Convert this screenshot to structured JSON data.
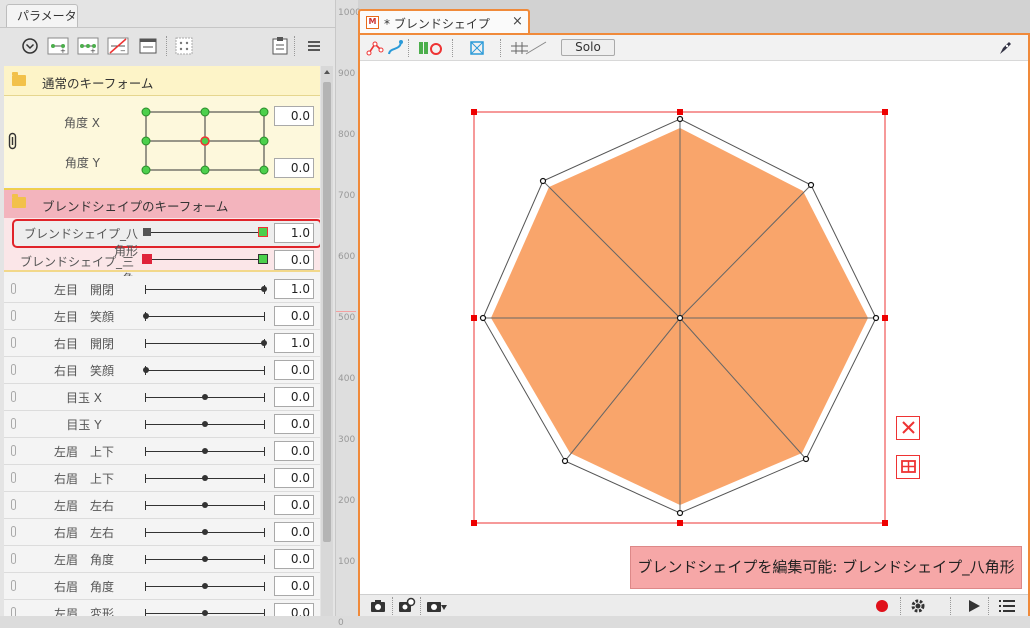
{
  "panel": {
    "tab": "パラメータ"
  },
  "group1": {
    "title": "通常のキーフォーム",
    "params": [
      {
        "label": "角度 X",
        "value": "0.0"
      },
      {
        "label": "角度 Y",
        "value": "0.0"
      }
    ]
  },
  "group2": {
    "title": "ブレンドシェイプのキーフォーム",
    "params": [
      {
        "label": "ブレンドシェイプ_八角形",
        "value": "1.0"
      },
      {
        "label": "ブレンドシェイプ_三角",
        "value": "0.0"
      }
    ]
  },
  "params": [
    {
      "label": "左目　開閉",
      "value": "1.0",
      "pos": 1.0
    },
    {
      "label": "左目　笑顔",
      "value": "0.0",
      "pos": 0.0
    },
    {
      "label": "右目　開閉",
      "value": "1.0",
      "pos": 1.0
    },
    {
      "label": "右目　笑顔",
      "value": "0.0",
      "pos": 0.0
    },
    {
      "label": "目玉 X",
      "value": "0.0",
      "pos": 0.5
    },
    {
      "label": "目玉 Y",
      "value": "0.0",
      "pos": 0.5
    },
    {
      "label": "左眉　上下",
      "value": "0.0",
      "pos": 0.5
    },
    {
      "label": "右眉　上下",
      "value": "0.0",
      "pos": 0.5
    },
    {
      "label": "左眉　左右",
      "value": "0.0",
      "pos": 0.5
    },
    {
      "label": "右眉　左右",
      "value": "0.0",
      "pos": 0.5
    },
    {
      "label": "左眉　角度",
      "value": "0.0",
      "pos": 0.5
    },
    {
      "label": "右眉　角度",
      "value": "0.0",
      "pos": 0.5
    },
    {
      "label": "左眉　変形",
      "value": "0.0",
      "pos": 0.5
    }
  ],
  "ruler": {
    "labels": [
      "1000",
      "900",
      "800",
      "700",
      "600",
      "500",
      "400",
      "300",
      "200",
      "100",
      "0"
    ]
  },
  "viewer": {
    "tab_title": "* ブレンドシェイプ",
    "tab_icon": "M",
    "close": "×",
    "solo_label": "Solo",
    "status": "ブレンドシェイプを編集可能: ブレンドシェイプ_八角形",
    "shape_fill": "#f9a56b"
  }
}
